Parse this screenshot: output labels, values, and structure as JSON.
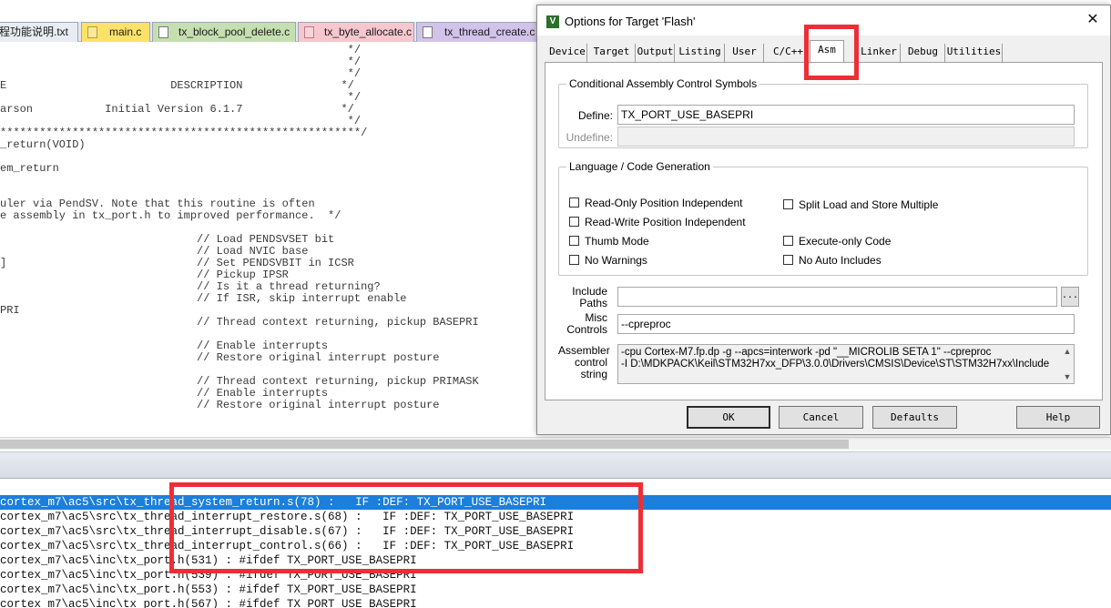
{
  "editor": {
    "tabs": [
      {
        "label": "程功能说明.txt"
      },
      {
        "label": "main.c"
      },
      {
        "label": "tx_block_pool_delete.c"
      },
      {
        "label": "tx_byte_allocate.c"
      },
      {
        "label": "tx_thread_create.c"
      }
    ],
    "code_lines": [
      "                                                     */",
      "                                                     */",
      "                                                     */",
      "E                         DESCRIPTION               */",
      "                                                     */",
      "arson           Initial Version 6.1.7               */",
      "                                                     */",
      "*******************************************************/",
      "_return(VOID)",
      "",
      "em_return",
      "",
      "",
      "uler via PendSV. Note that this routine is often",
      "e assembly in tx_port.h to improved performance.  */",
      "",
      "                              // Load PENDSVSET bit",
      "                              // Load NVIC base",
      "]                             // Set PENDSVBIT in ICSR",
      "                              // Pickup IPSR",
      "                              // Is it a thread returning?",
      "                              // If ISR, skip interrupt enable",
      "PRI",
      "                              // Thread context returning, pickup BASEPRI",
      "",
      "                              // Enable interrupts",
      "                              // Restore original interrupt posture",
      "",
      "                              // Thread context returning, pickup PRIMASK",
      "                              // Enable interrupts",
      "                              // Restore original interrupt posture"
    ]
  },
  "find_results": [
    "cortex_m7\\ac5\\src\\tx_thread_system_return.s(78) :   IF :DEF: TX_PORT_USE_BASEPRI",
    "cortex_m7\\ac5\\src\\tx_thread_interrupt_restore.s(68) :   IF :DEF: TX_PORT_USE_BASEPRI",
    "cortex_m7\\ac5\\src\\tx_thread_interrupt_disable.s(67) :   IF :DEF: TX_PORT_USE_BASEPRI",
    "cortex_m7\\ac5\\src\\tx_thread_interrupt_control.s(66) :   IF :DEF: TX_PORT_USE_BASEPRI",
    "cortex_m7\\ac5\\inc\\tx_port.h(531) : #ifdef TX_PORT_USE_BASEPRI",
    "cortex_m7\\ac5\\inc\\tx_port.h(539) : #ifdef TX_PORT_USE_BASEPRI",
    "cortex_m7\\ac5\\inc\\tx_port.h(553) : #ifdef TX_PORT_USE_BASEPRI",
    "cortex_m7\\ac5\\inc\\tx_port.h(567) : #ifdef TX_PORT_USE_BASEPRI"
  ],
  "dialog": {
    "title": "Options for Target 'Flash'",
    "close": "✕",
    "tabs": [
      "Device",
      "Target",
      "Output",
      "Listing",
      "User",
      "C/C++",
      "Asm",
      "Linker",
      "Debug",
      "Utilities"
    ],
    "active_tab": "Asm",
    "conditional": {
      "legend": "Conditional Assembly Control Symbols",
      "define_label": "Define:",
      "define_value": "TX_PORT_USE_BASEPRI",
      "undefine_label": "Undefine:",
      "undefine_value": ""
    },
    "language": {
      "legend": "Language / Code Generation",
      "options": [
        {
          "label": "Read-Only Position Independent",
          "checked": false
        },
        {
          "label": "Read-Write Position Independent",
          "checked": false
        },
        {
          "label": "Thumb Mode",
          "checked": false
        },
        {
          "label": "No Warnings",
          "checked": false
        },
        {
          "label": "Split Load and Store Multiple",
          "checked": false
        },
        {
          "label": "Execute-only Code",
          "checked": false
        },
        {
          "label": "No Auto Includes",
          "checked": false
        }
      ]
    },
    "include_paths_label_1": "Include",
    "include_paths_label_2": "Paths",
    "include_paths_value": "",
    "browse_label": "...",
    "misc_label_1": "Misc",
    "misc_label_2": "Controls",
    "misc_value": "--cpreproc",
    "asm_label_1": "Assembler",
    "asm_label_2": "control",
    "asm_label_3": "string",
    "asm_line_1": "-cpu Cortex-M7.fp.dp -g --apcs=interwork -pd \"__MICROLIB SETA 1\" --cpreproc",
    "asm_line_2": "-I D:\\MDKPACK\\Keil\\STM32H7xx_DFP\\3.0.0\\Drivers\\CMSIS\\Device\\ST\\STM32H7xx\\Include",
    "buttons": {
      "ok": "OK",
      "cancel": "Cancel",
      "defaults": "Defaults",
      "help": "Help"
    }
  },
  "colors": {
    "highlight": "#ee2e35",
    "selection": "#1b7fdb",
    "tab_yellow": "#fde26a",
    "tab_green": "#c6dfb1",
    "tab_pink": "#f6c7cf",
    "tab_purple": "#d2c3ea"
  }
}
